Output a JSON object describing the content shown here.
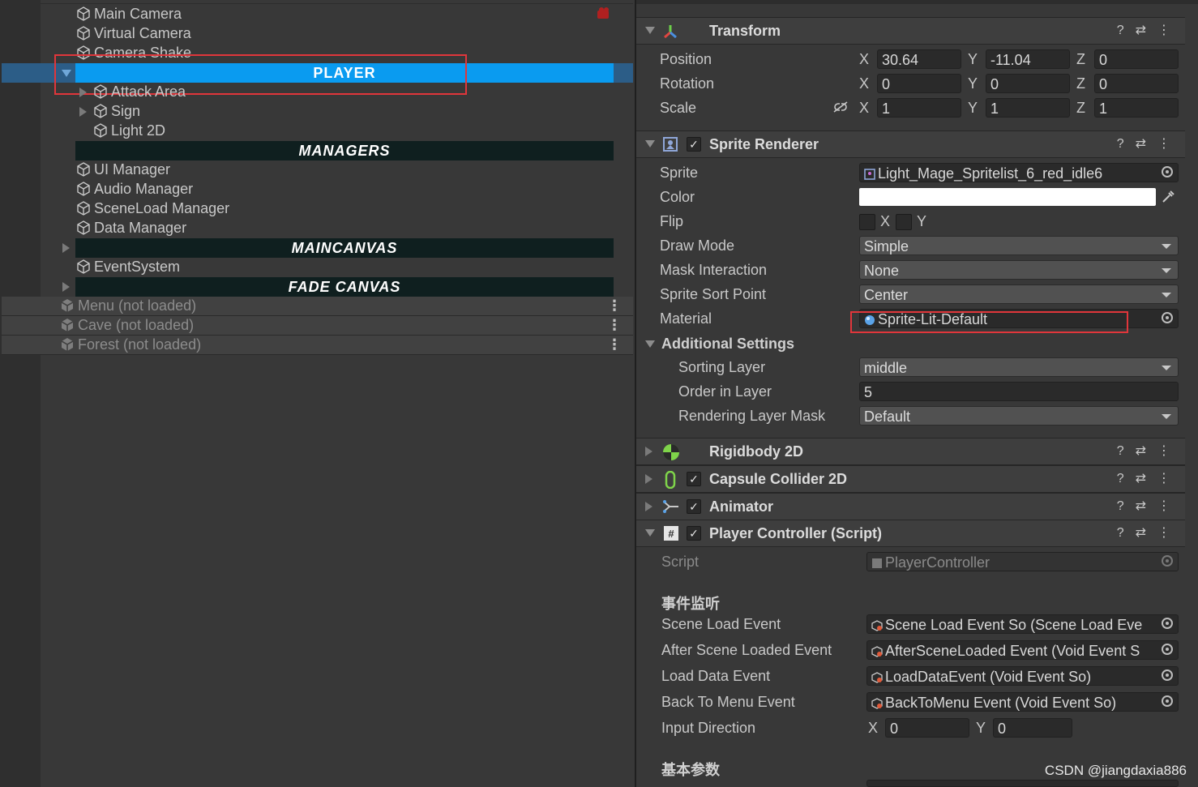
{
  "hierarchy": {
    "items_top": [
      "Main Camera",
      "Virtual Camera",
      "Camera Shake"
    ],
    "player_header": "PLAYER",
    "player_children": [
      "Attack Area",
      "Sign",
      "Light 2D"
    ],
    "managers_header": "MANAGERS",
    "managers": [
      "UI Manager",
      "Audio Manager",
      "SceneLoad Manager",
      "Data Manager"
    ],
    "maincanvas_header": "MAINCANVAS",
    "eventsystem": "EventSystem",
    "fadecanvas_header": "FADE CANVAS",
    "scenes": [
      "Menu (not loaded)",
      "Cave (not loaded)",
      "Forest (not loaded)"
    ],
    "kebab": "⋮"
  },
  "inspector": {
    "transform": {
      "title": "Transform",
      "rows": [
        {
          "label": "Position",
          "x": "30.64",
          "y": "-11.04",
          "z": "0"
        },
        {
          "label": "Rotation",
          "x": "0",
          "y": "0",
          "z": "0"
        },
        {
          "label": "Scale",
          "x": "1",
          "y": "1",
          "z": "1"
        }
      ],
      "axis_x": "X",
      "axis_y": "Y",
      "axis_z": "Z"
    },
    "sprite_renderer": {
      "title": "Sprite Renderer",
      "sprite_label": "Sprite",
      "sprite_value": "Light_Mage_Spritelist_6_red_idle6",
      "color_label": "Color",
      "color_value": "#ffffff",
      "flip_label": "Flip",
      "flip_x": "X",
      "flip_y": "Y",
      "draw_mode_label": "Draw Mode",
      "draw_mode_value": "Simple",
      "mask_label": "Mask Interaction",
      "mask_value": "None",
      "sort_point_label": "Sprite Sort Point",
      "sort_point_value": "Center",
      "material_label": "Material",
      "material_value": "Sprite-Lit-Default",
      "additional_label": "Additional Settings",
      "sorting_layer_label": "Sorting Layer",
      "sorting_layer_value": "middle",
      "order_label": "Order in Layer",
      "order_value": "5",
      "rlm_label": "Rendering Layer Mask",
      "rlm_value": "Default"
    },
    "rigidbody": {
      "title": "Rigidbody 2D"
    },
    "capsule": {
      "title": "Capsule Collider 2D"
    },
    "animator": {
      "title": "Animator"
    },
    "player_controller": {
      "title": "Player Controller (Script)",
      "script_label": "Script",
      "script_value": "PlayerController",
      "events_header": "事件监听",
      "events": [
        {
          "label": "Scene Load Event",
          "value": "Scene Load Event So (Scene Load Eve"
        },
        {
          "label": "After Scene Loaded Event",
          "value": "AfterSceneLoaded Event (Void Event S"
        },
        {
          "label": "Load Data Event",
          "value": "LoadDataEvent (Void Event So)"
        },
        {
          "label": "Back To Menu Event",
          "value": "BackToMenu Event (Void Event So)"
        }
      ],
      "input_label": "Input Direction",
      "input_x": "0",
      "input_y": "0",
      "basic_header": "基本参数"
    },
    "icons": {
      "help": "?",
      "preset": "⇄",
      "menu": "⋮"
    }
  },
  "watermark": "CSDN @jiangdaxia886",
  "colors": {
    "selection": "#0a9bf0",
    "highlight_box": "#e0363b",
    "header_bar": "#0f1f1f"
  }
}
